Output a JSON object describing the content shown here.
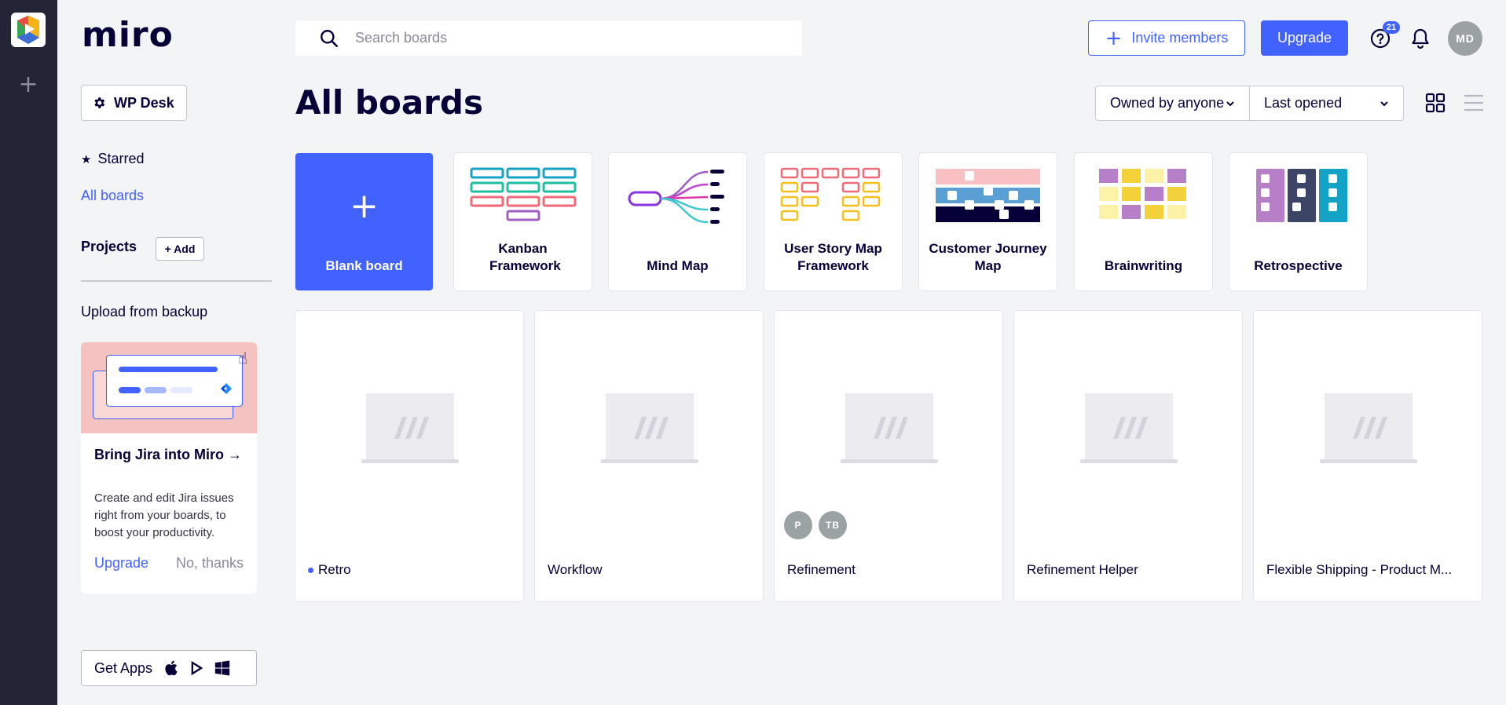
{
  "app": {
    "logo_text": "miro"
  },
  "header": {
    "search_placeholder": "Search boards",
    "invite_label": "Invite members",
    "upgrade_label": "Upgrade",
    "help_badge": "21",
    "avatar_initials": "MD"
  },
  "sidebar": {
    "workspace_label": "WP Desk",
    "starred_label": "Starred",
    "all_boards_label": "All boards",
    "projects_label": "Projects",
    "add_project_label": "+ Add",
    "upload_label": "Upload from backup",
    "jira_promo": {
      "title": "Bring Jira into Miro →",
      "description": "Create and edit Jira issues right from your boards, to boost your productivity.",
      "upgrade_label": "Upgrade",
      "dismiss_label": "No, thanks"
    },
    "get_apps_label": "Get Apps"
  },
  "main": {
    "title": "All boards",
    "filters": {
      "owner": "Owned by anyone",
      "sort": "Last opened"
    },
    "templates": [
      {
        "name": "Blank board"
      },
      {
        "name": "Kanban Framework"
      },
      {
        "name": "Mind Map"
      },
      {
        "name": "User Story Map Framework"
      },
      {
        "name": "Customer Journey Map"
      },
      {
        "name": "Brainwriting"
      },
      {
        "name": "Retrospective"
      }
    ],
    "boards": [
      {
        "name": "Retro",
        "collaborators": []
      },
      {
        "name": "Workflow",
        "collaborators": []
      },
      {
        "name": "Refinement",
        "collaborators": [
          "P",
          "TB"
        ]
      },
      {
        "name": "Refinement Helper",
        "collaborators": []
      },
      {
        "name": "Flexible Shipping - Product M...",
        "collaborators": []
      }
    ]
  },
  "colors": {
    "accent": "#4262ff",
    "rail": "#242437",
    "background": "#f3f4f6"
  }
}
